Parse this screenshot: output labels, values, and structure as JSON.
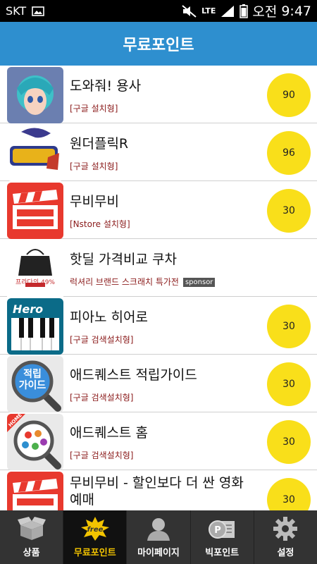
{
  "status_bar": {
    "carrier": "SKT",
    "network": "LTE",
    "ampm": "오전",
    "time": "9:47"
  },
  "header": {
    "title": "무료포인트"
  },
  "apps": [
    {
      "title": "도와줘! 용사",
      "type": "[구글 설치형]",
      "points": "90",
      "icon": "anime-girl"
    },
    {
      "title": "원더플릭R",
      "type": "[구글 설치형]",
      "points": "96",
      "icon": "wonderflick-logo"
    },
    {
      "title": "무비무비",
      "type": "[Nstore 설치형]",
      "points": "30",
      "icon": "movie-clapper"
    },
    {
      "title": "핫딜 가격비교 쿠차",
      "type": "럭셔리 브랜드 스크래치 특가전",
      "badge": "sponsor",
      "icon": "handbag-ad",
      "ad_text": "프라다의 49%"
    },
    {
      "title": "피아노 히어로",
      "type": "[구글 검색설치형]",
      "points": "30",
      "icon": "piano-keys",
      "icon_label": "Hero"
    },
    {
      "title": "애드퀘스트 적립가이드",
      "type": "[구글 검색설치형]",
      "points": "30",
      "icon": "magnifier",
      "icon_label": "적립\n가이드"
    },
    {
      "title": "애드퀘스트 홈",
      "type": "[구글 검색설치형]",
      "points": "30",
      "icon": "magnifier-dots",
      "icon_label": "HOME"
    },
    {
      "title": "무비무비 - 할인보다 더 싼 영화 예매",
      "type": "",
      "points": "30",
      "icon": "movie-clapper"
    }
  ],
  "bottom_nav": [
    {
      "label": "상품",
      "icon": "box-icon",
      "active": false
    },
    {
      "label": "무료포인트",
      "icon": "free-icon",
      "active": true
    },
    {
      "label": "마이페이지",
      "icon": "person-icon",
      "active": false
    },
    {
      "label": "빅포인트",
      "icon": "points-icon",
      "active": false
    },
    {
      "label": "설정",
      "icon": "gear-icon",
      "active": false
    }
  ],
  "colors": {
    "header": "#2e8fcf",
    "points_badge": "#f9df1a",
    "nav_bg": "#333333",
    "nav_active": "#f3c400"
  }
}
